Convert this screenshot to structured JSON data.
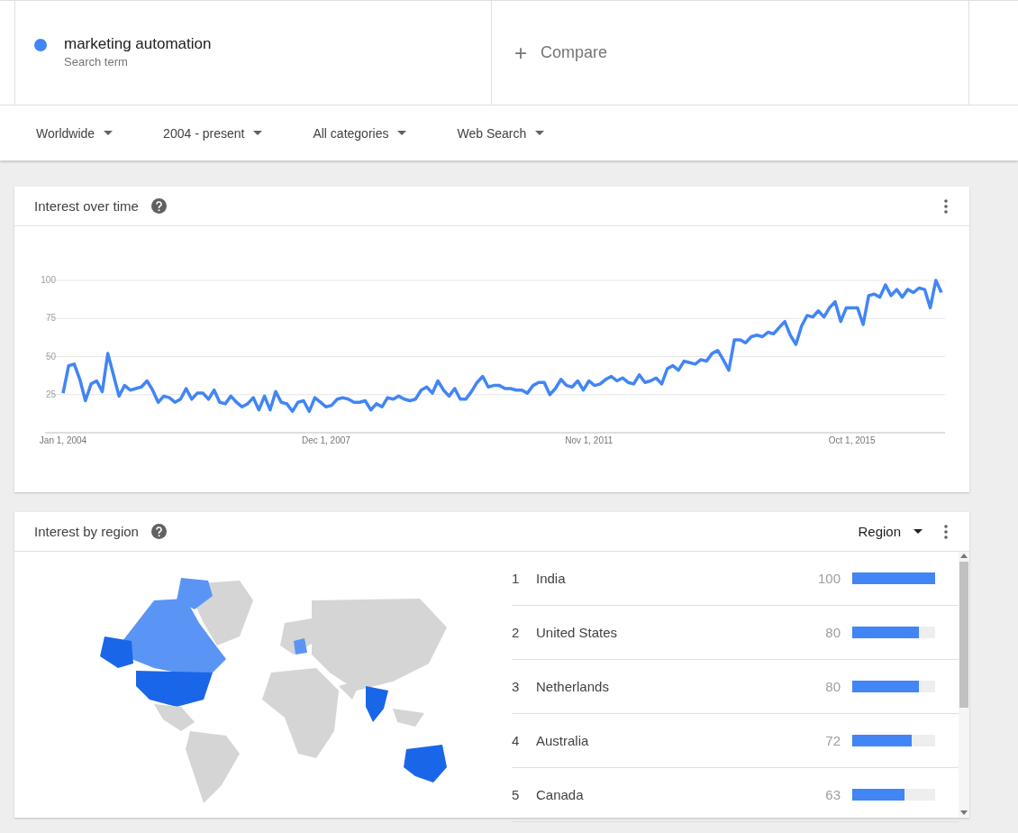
{
  "search_term": {
    "label": "marketing automation",
    "caption": "Search term"
  },
  "compare": {
    "label": "Compare",
    "icon": "+"
  },
  "filters": [
    {
      "label": "Worldwide"
    },
    {
      "label": "2004 - present"
    },
    {
      "label": "All categories"
    },
    {
      "label": "Web Search"
    }
  ],
  "interest_over_time": {
    "title": "Interest over time",
    "chart_data": {
      "type": "line",
      "grid": true,
      "categories": [
        "Jan 1, 2004",
        null,
        null,
        null,
        null,
        null,
        null,
        null,
        null,
        null,
        null,
        null,
        null,
        null,
        null,
        null,
        null,
        null,
        null,
        null,
        null,
        null,
        null,
        null,
        null,
        null,
        null,
        null,
        null,
        null,
        null,
        null,
        null,
        null,
        null,
        null,
        null,
        null,
        null,
        null,
        null,
        null,
        null,
        null,
        null,
        null,
        null,
        "Dec 1, 2007",
        null,
        null,
        null,
        null,
        null,
        null,
        null,
        null,
        null,
        null,
        null,
        null,
        null,
        null,
        null,
        null,
        null,
        null,
        null,
        null,
        null,
        null,
        null,
        null,
        null,
        null,
        null,
        null,
        null,
        null,
        null,
        null,
        null,
        null,
        null,
        null,
        null,
        null,
        null,
        null,
        null,
        null,
        null,
        null,
        null,
        null,
        "Nov 1, 2011",
        null,
        null,
        null,
        null,
        null,
        null,
        null,
        null,
        null,
        null,
        null,
        null,
        null,
        null,
        null,
        null,
        null,
        null,
        null,
        null,
        null,
        null,
        null,
        null,
        null,
        null,
        null,
        null,
        null,
        null,
        null,
        null,
        null,
        null,
        null,
        null,
        null,
        null,
        null,
        null,
        null,
        null,
        null,
        null,
        null,
        null,
        "Oct 1, 2015",
        null,
        null,
        null,
        null,
        null,
        null,
        null,
        null,
        null,
        null,
        null,
        null,
        null,
        null,
        null,
        null
      ],
      "yticks": [
        25,
        50,
        75,
        100
      ],
      "ylim": [
        0,
        100
      ],
      "series": [
        {
          "color": "#4285f4",
          "values": [
            26,
            44,
            45,
            35,
            21,
            32,
            34,
            27,
            52,
            38,
            24,
            31,
            28,
            29,
            30,
            34,
            28,
            20,
            24,
            23,
            20,
            22,
            29,
            22,
            26,
            26,
            22,
            28,
            20,
            19,
            24,
            20,
            17,
            19,
            23,
            15,
            24,
            15,
            27,
            20,
            19,
            14,
            20,
            21,
            14,
            23,
            20,
            17,
            18,
            22,
            23,
            22,
            20,
            20,
            21,
            15,
            19,
            17,
            23,
            22,
            24,
            22,
            21,
            22,
            28,
            30,
            26,
            34,
            28,
            24,
            29,
            22,
            22,
            27,
            33,
            37,
            30,
            31,
            31,
            29,
            29,
            28,
            28,
            26,
            31,
            33,
            33,
            25,
            29,
            35,
            31,
            30,
            34,
            28,
            34,
            31,
            32,
            35,
            37,
            34,
            36,
            33,
            32,
            38,
            33,
            34,
            36,
            32,
            42,
            44,
            41,
            47,
            46,
            45,
            48,
            47,
            52,
            54,
            48,
            41,
            61,
            61,
            59,
            63,
            64,
            63,
            66,
            65,
            69,
            73,
            64,
            58,
            70,
            77,
            76,
            80,
            76,
            82,
            86,
            73,
            82,
            82,
            82,
            71,
            90,
            91,
            89,
            97,
            90,
            94,
            89,
            94,
            92,
            95,
            94,
            82,
            100,
            92
          ]
        }
      ]
    }
  },
  "interest_by_region": {
    "title": "Interest by region",
    "resolution": "Region",
    "rows": [
      {
        "rank": "1",
        "name": "India",
        "value": "100",
        "level": 1.0
      },
      {
        "rank": "2",
        "name": "United States",
        "value": "80",
        "level": 0.8
      },
      {
        "rank": "3",
        "name": "Netherlands",
        "value": "80",
        "level": 0.8
      },
      {
        "rank": "4",
        "name": "Australia",
        "value": "72",
        "level": 0.72
      },
      {
        "rank": "5",
        "name": "Canada",
        "value": "63",
        "level": 0.63
      }
    ]
  }
}
